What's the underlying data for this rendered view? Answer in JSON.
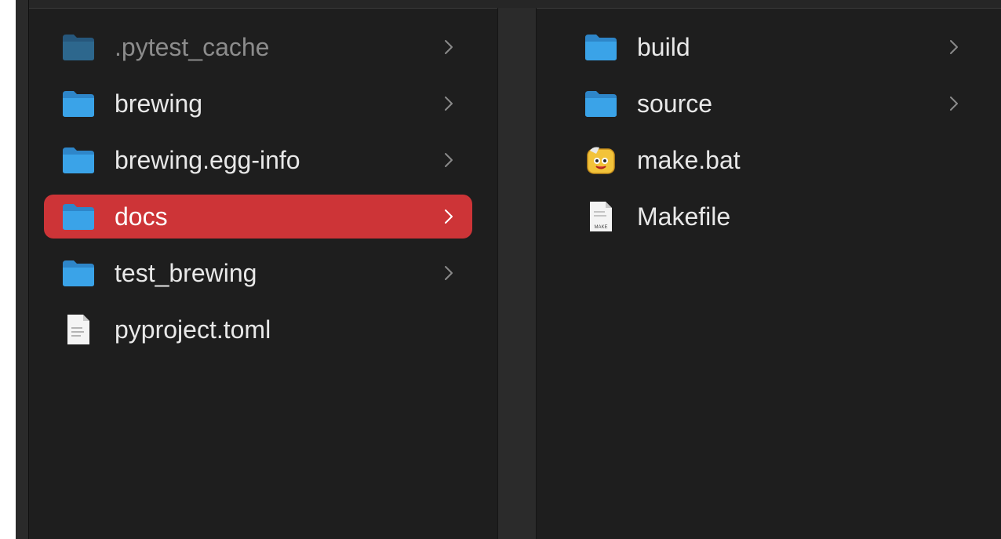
{
  "columns": [
    {
      "items": [
        {
          "label": ".pytest_cache",
          "icon": "folder-icon",
          "has_children": true,
          "dimmed": true,
          "selected": false
        },
        {
          "label": "brewing",
          "icon": "folder-icon",
          "has_children": true,
          "dimmed": false,
          "selected": false
        },
        {
          "label": "brewing.egg-info",
          "icon": "folder-icon",
          "has_children": true,
          "dimmed": false,
          "selected": false
        },
        {
          "label": "docs",
          "icon": "folder-icon",
          "has_children": true,
          "dimmed": false,
          "selected": true
        },
        {
          "label": "test_brewing",
          "icon": "folder-icon",
          "has_children": true,
          "dimmed": false,
          "selected": false
        },
        {
          "label": "pyproject.toml",
          "icon": "document-icon",
          "has_children": false,
          "dimmed": false,
          "selected": false
        }
      ]
    },
    {
      "items": [
        {
          "label": "build",
          "icon": "folder-icon",
          "has_children": true,
          "dimmed": false,
          "selected": false
        },
        {
          "label": "source",
          "icon": "folder-icon",
          "has_children": true,
          "dimmed": false,
          "selected": false
        },
        {
          "label": "make.bat",
          "icon": "batch-file-icon",
          "has_children": false,
          "dimmed": false,
          "selected": false
        },
        {
          "label": "Makefile",
          "icon": "makefile-icon",
          "has_children": false,
          "dimmed": false,
          "selected": false,
          "badge": "MAKE"
        }
      ]
    }
  ],
  "colors": {
    "window_bg": "#1e1e1e",
    "selection": "#cd3437",
    "folder": "#3aa3e8",
    "text": "#e8e8e8",
    "dim_text": "#8c8c8c"
  }
}
